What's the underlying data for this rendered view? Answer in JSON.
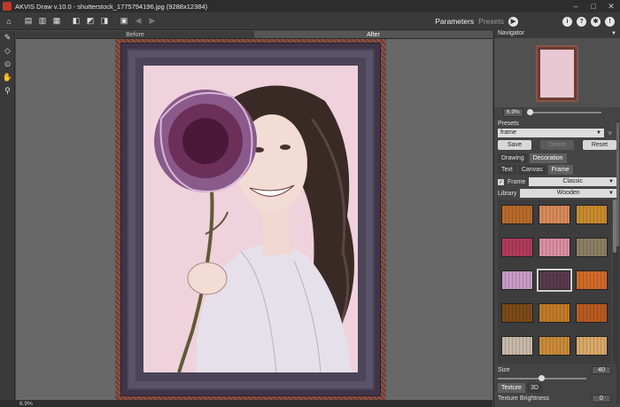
{
  "window": {
    "title": "AKVIS Draw v.10.0 - shutterstock_1775794196.jpg (9288x12384)",
    "controls": [
      "–",
      "□",
      "✕"
    ]
  },
  "toolbar": {
    "icons": [
      "open-icon",
      "save-icon",
      "save-as-icon",
      "print-icon",
      "batch-icon",
      "batch-settings-icon",
      "export-icon",
      "share-icon",
      "undo-icon",
      "redo-icon"
    ],
    "parameters_label": "Parameters",
    "presets_label": "Presets",
    "run_icon": "play-icon",
    "help_icon": "i",
    "question_icon": "?",
    "settings_icon": "gear-icon",
    "info_icon": "!"
  },
  "tools": [
    "pencil-icon",
    "eraser-icon",
    "stamp-icon",
    "hand-icon",
    "zoom-icon"
  ],
  "view_tabs": {
    "before": "Before",
    "after": "After"
  },
  "status": {
    "zoom": "6.9%"
  },
  "navigator": {
    "title": "Navigator",
    "zoom": "6.9%"
  },
  "presets": {
    "title": "Presets",
    "selected": "frame",
    "save": "Save",
    "delete": "Delete",
    "reset": "Reset"
  },
  "tabs_top": [
    "Drawing",
    "Decoration"
  ],
  "tabs_sub": [
    "Text",
    "Canvas",
    "Frame"
  ],
  "frame": {
    "checkbox_label": "Frame",
    "checked": true,
    "style": "Classic",
    "library_label": "Library",
    "library": "Wooden"
  },
  "swatches": [
    "#b86a2a",
    "#d8895a",
    "#c98a2c",
    "#b03a5a",
    "#d88ea0",
    "#8a7e64",
    "#c79ac8",
    "#5a3a4a",
    "#d06a28",
    "#7a4a18",
    "#c27a28",
    "#b85a20",
    "#c8b8a8",
    "#c88a3a",
    "#d8a868"
  ],
  "size": {
    "label": "Size",
    "value": "40",
    "fraction": 0.4
  },
  "bottom_tabs": [
    "Texture",
    "3D"
  ],
  "texture": {
    "brightness_label": "Texture Brightness",
    "brightness_value": "0"
  }
}
